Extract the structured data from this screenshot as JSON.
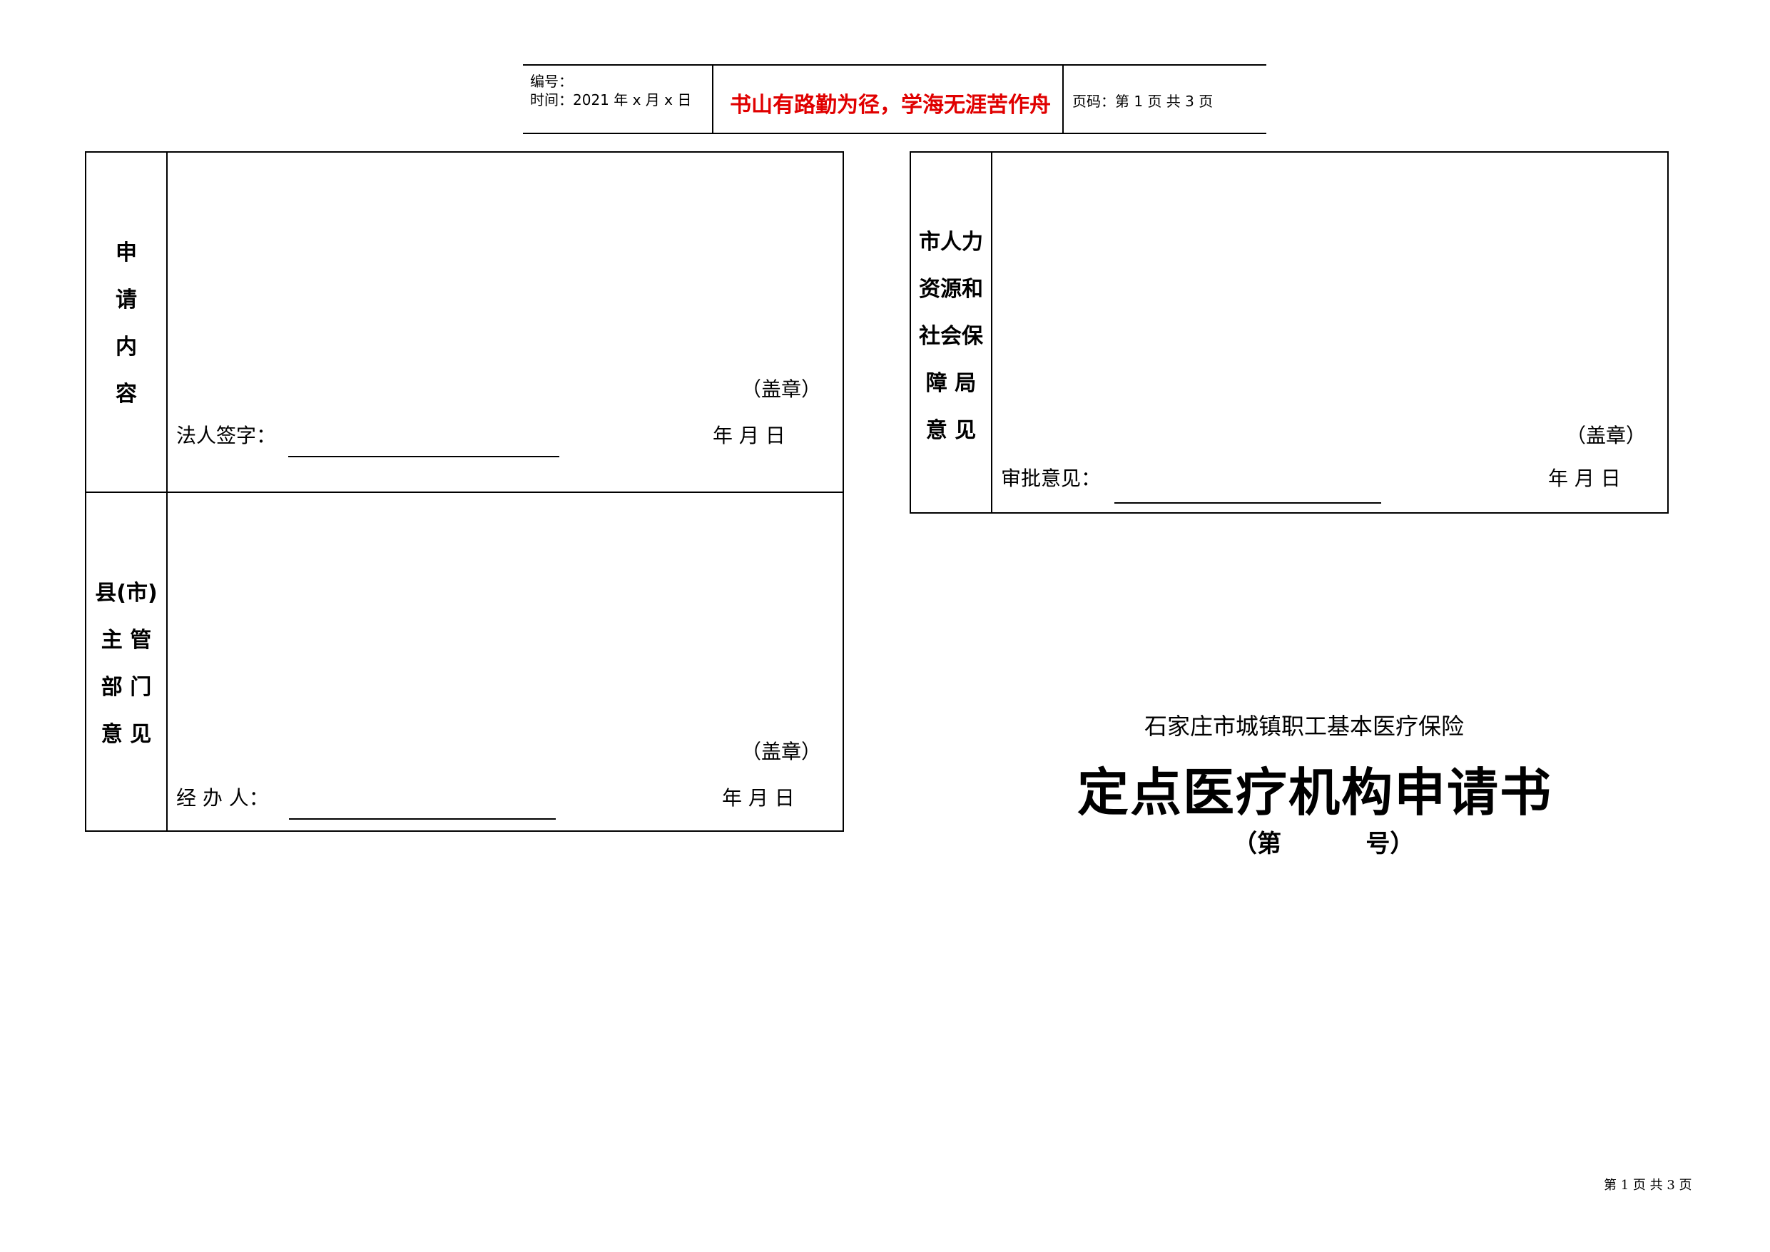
{
  "header": {
    "serial_label": "编号：",
    "time_label": "时间：2021 年 x 月 x 日",
    "motto": "书山有路勤为径，学海无涯苦作舟",
    "page_info": "页码：第 1 页  共 3 页"
  },
  "form_apply": {
    "label_lines": [
      "申",
      "请",
      "内",
      "容"
    ],
    "seal": "（盖章）",
    "signer": "法人签字：",
    "date": "年    月    日"
  },
  "form_county": {
    "label_lines": [
      "县(市)",
      "主  管",
      "部  门",
      "意  见"
    ],
    "seal": "（盖章）",
    "signer": "经 办 人：",
    "date": "年    月    日"
  },
  "form_city": {
    "label_lines": [
      "市人力",
      "资源和",
      "社会保",
      "障  局",
      "意  见"
    ],
    "seal": "（盖章）",
    "signer": "审批意见：",
    "date": "年    月    日"
  },
  "cover": {
    "subtitle": "石家庄市城镇职工基本医疗保险",
    "title": "定点医疗机构申请书",
    "number": "（第          号）"
  },
  "footer": {
    "page": "第 1 页 共 3 页"
  }
}
